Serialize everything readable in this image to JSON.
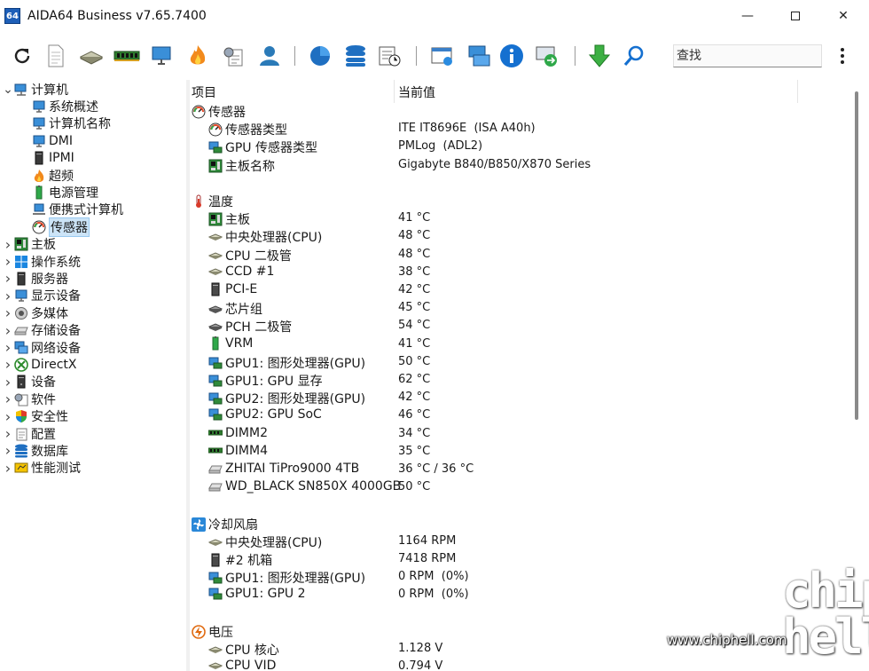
{
  "window": {
    "title": "AIDA64 Business v7.65.7400",
    "logo_text": "64",
    "min_glyph": "—",
    "close_glyph": "✕"
  },
  "toolbar": {
    "search_placeholder": "查找"
  },
  "tree": {
    "items": [
      {
        "label": "计算机",
        "icon": "computer-icon",
        "expanded": true
      },
      {
        "label": "系统概述",
        "icon": "monitor-icon"
      },
      {
        "label": "计算机名称",
        "icon": "monitor-icon"
      },
      {
        "label": "DMI",
        "icon": "monitor-icon"
      },
      {
        "label": "IPMI",
        "icon": "server-icon"
      },
      {
        "label": "超频",
        "icon": "flame-icon"
      },
      {
        "label": "电源管理",
        "icon": "battery-icon"
      },
      {
        "label": "便携式计算机",
        "icon": "laptop-icon"
      },
      {
        "label": "传感器",
        "icon": "gauge-icon",
        "selected": true
      },
      {
        "label": "主板",
        "icon": "motherboard-icon"
      },
      {
        "label": "操作系统",
        "icon": "windows-icon"
      },
      {
        "label": "服务器",
        "icon": "server-icon"
      },
      {
        "label": "显示设备",
        "icon": "monitor-icon"
      },
      {
        "label": "多媒体",
        "icon": "speaker-icon"
      },
      {
        "label": "存储设备",
        "icon": "drive-icon"
      },
      {
        "label": "网络设备",
        "icon": "network-icon"
      },
      {
        "label": "DirectX",
        "icon": "xbox-icon"
      },
      {
        "label": "设备",
        "icon": "devices-icon"
      },
      {
        "label": "软件",
        "icon": "software-icon"
      },
      {
        "label": "安全性",
        "icon": "shield-icon"
      },
      {
        "label": "配置",
        "icon": "config-icon"
      },
      {
        "label": "数据库",
        "icon": "database-icon"
      },
      {
        "label": "性能测试",
        "icon": "benchmark-icon"
      }
    ]
  },
  "list": {
    "col_item": "项目",
    "col_value": "当前值",
    "rows": [
      {
        "type": "group",
        "label": "传感器",
        "icon": "gauge-icon"
      },
      {
        "type": "item",
        "label": "传感器类型",
        "value": "ITE IT8696E  (ISA A40h)",
        "icon": "gauge-icon"
      },
      {
        "type": "item",
        "label": "GPU 传感器类型",
        "value": "PMLog  (ADL2)",
        "icon": "gpu-icon"
      },
      {
        "type": "item",
        "label": "主板名称",
        "value": "Gigabyte B840/B850/X870 Series",
        "icon": "motherboard-icon"
      },
      {
        "type": "blank"
      },
      {
        "type": "group",
        "label": "温度",
        "icon": "thermometer-icon"
      },
      {
        "type": "item",
        "label": "主板",
        "value": "41 °C",
        "icon": "motherboard-icon"
      },
      {
        "type": "item",
        "label": "中央处理器(CPU)",
        "value": "48 °C",
        "icon": "cpu-icon"
      },
      {
        "type": "item",
        "label": "CPU 二极管",
        "value": "48 °C",
        "icon": "cpu-icon"
      },
      {
        "type": "item",
        "label": "CCD #1",
        "value": "38 °C",
        "icon": "cpu-icon"
      },
      {
        "type": "item",
        "label": "PCI-E",
        "value": "42 °C",
        "icon": "tower-icon"
      },
      {
        "type": "item",
        "label": "芯片组",
        "value": "45 °C",
        "icon": "chip-icon"
      },
      {
        "type": "item",
        "label": "PCH 二极管",
        "value": "54 °C",
        "icon": "chip-icon"
      },
      {
        "type": "item",
        "label": "VRM",
        "value": "41 °C",
        "icon": "battery-icon"
      },
      {
        "type": "item",
        "label": "GPU1: 图形处理器(GPU)",
        "value": "50 °C",
        "icon": "gpu-icon"
      },
      {
        "type": "item",
        "label": "GPU1: GPU 显存",
        "value": "62 °C",
        "icon": "gpu-icon"
      },
      {
        "type": "item",
        "label": "GPU2: 图形处理器(GPU)",
        "value": "42 °C",
        "icon": "gpu-icon"
      },
      {
        "type": "item",
        "label": "GPU2: GPU SoC",
        "value": "46 °C",
        "icon": "gpu-icon"
      },
      {
        "type": "item",
        "label": "DIMM2",
        "value": "34 °C",
        "icon": "ram-icon"
      },
      {
        "type": "item",
        "label": "DIMM4",
        "value": "35 °C",
        "icon": "ram-icon"
      },
      {
        "type": "item",
        "label": "ZHITAI TiPro9000 4TB",
        "value": "36 °C / 36 °C",
        "icon": "drive-icon"
      },
      {
        "type": "item",
        "label": "WD_BLACK SN850X 4000GB",
        "value": "50 °C",
        "icon": "drive-icon"
      },
      {
        "type": "blank"
      },
      {
        "type": "group",
        "label": "冷却风扇",
        "icon": "fan-icon"
      },
      {
        "type": "item",
        "label": "中央处理器(CPU)",
        "value": "1164 RPM",
        "icon": "cpu-icon"
      },
      {
        "type": "item",
        "label": "#2 机箱",
        "value": "7418 RPM",
        "icon": "tower-icon"
      },
      {
        "type": "item",
        "label": "GPU1: 图形处理器(GPU)",
        "value": "0 RPM  (0%)",
        "icon": "gpu-icon"
      },
      {
        "type": "item",
        "label": "GPU1: GPU 2",
        "value": "0 RPM  (0%)",
        "icon": "gpu-icon"
      },
      {
        "type": "blank"
      },
      {
        "type": "group",
        "label": "电压",
        "icon": "voltage-icon"
      },
      {
        "type": "item",
        "label": "CPU 核心",
        "value": "1.128 V",
        "icon": "cpu-icon"
      },
      {
        "type": "item",
        "label": "CPU VID",
        "value": "0.794 V",
        "icon": "cpu-icon"
      }
    ]
  },
  "watermark": {
    "url": "www.chiphell.com",
    "logo": "chip hell"
  },
  "colors": {
    "selection": "#cce4f7",
    "accent_blue": "#1e5fb8"
  }
}
